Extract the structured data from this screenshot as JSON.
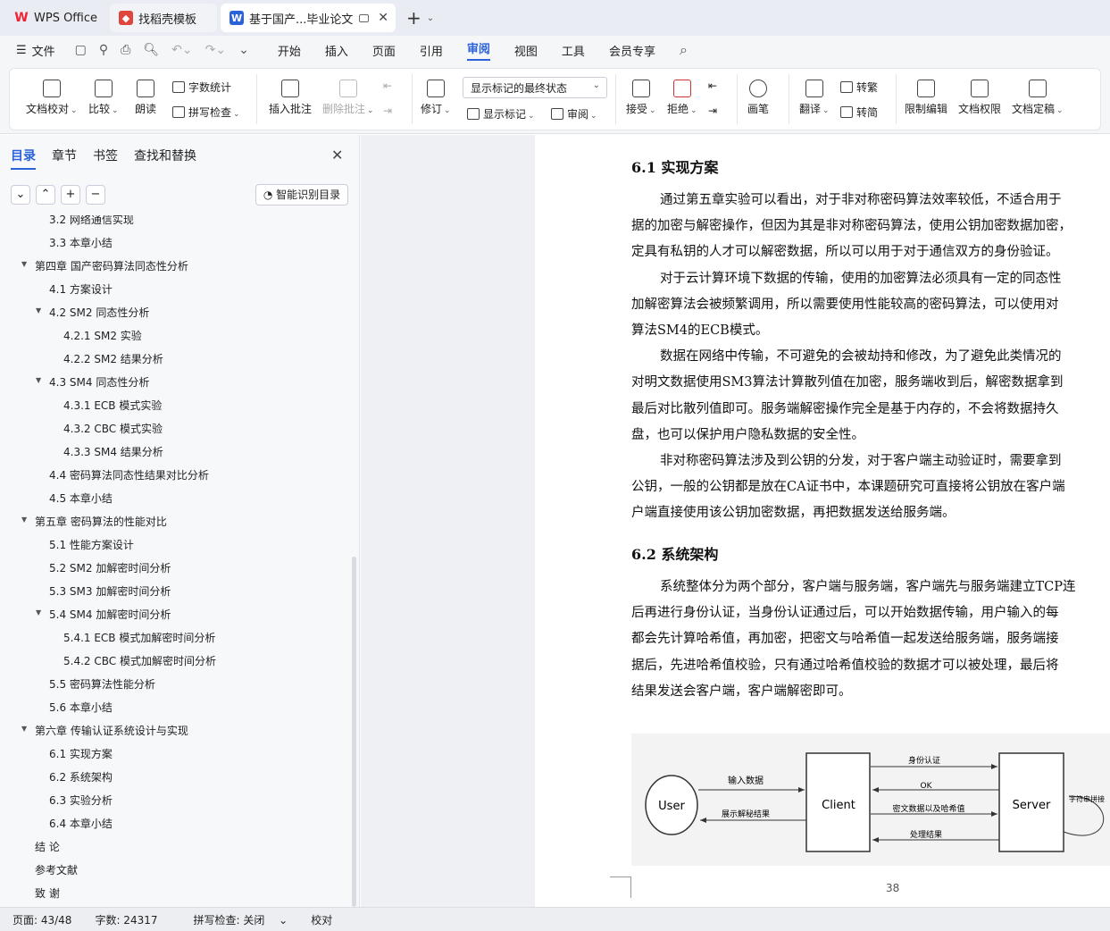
{
  "tabs": [
    {
      "label": "WPS Office"
    },
    {
      "label": "找稻壳模板"
    },
    {
      "label": "基于国产...毕业论文"
    }
  ],
  "menu": {
    "file": "文件",
    "items": [
      "开始",
      "插入",
      "页面",
      "引用",
      "审阅",
      "视图",
      "工具",
      "会员专享"
    ]
  },
  "ribbon": {
    "doc_check": "文档校对",
    "compare": "比较",
    "read": "朗读",
    "word_count": "字数统计",
    "spell_check": "拼写检查",
    "insert_comment": "插入批注",
    "delete_comment": "删除批注",
    "revise": "修订",
    "show_state": "显示标记的最终状态",
    "show_mark": "显示标记",
    "review_pane": "审阅",
    "accept": "接受",
    "reject": "拒绝",
    "pen": "画笔",
    "translate": "翻译",
    "to_trad": "转繁",
    "to_simp": "转简",
    "restrict_edit": "限制编辑",
    "doc_perm": "文档权限",
    "doc_finalize": "文档定稿"
  },
  "nav": {
    "tabs": [
      "目录",
      "章节",
      "书签",
      "查找和替换"
    ],
    "smart": "智能识别目录"
  },
  "toc": [
    {
      "t": "3.2  网络通信实现",
      "l": 2
    },
    {
      "t": "3.3  本章小结",
      "l": 2
    },
    {
      "t": "第四章  国产密码算法同态性分析",
      "l": 1,
      "a": true
    },
    {
      "t": "4.1  方案设计",
      "l": 2
    },
    {
      "t": "4.2 SM2 同态性分析",
      "l": 2,
      "a": true
    },
    {
      "t": "4.2.1 SM2 实验",
      "l": 3
    },
    {
      "t": "4.2.2 SM2 结果分析",
      "l": 3
    },
    {
      "t": "4.3 SM4 同态性分析",
      "l": 2,
      "a": true
    },
    {
      "t": "4.3.1 ECB 模式实验",
      "l": 3
    },
    {
      "t": "4.3.2 CBC 模式实验",
      "l": 3
    },
    {
      "t": "4.3.3 SM4 结果分析",
      "l": 3
    },
    {
      "t": "4.4  密码算法同态性结果对比分析",
      "l": 2
    },
    {
      "t": "4.5 本章小结",
      "l": 2
    },
    {
      "t": "第五章  密码算法的性能对比",
      "l": 1,
      "a": true
    },
    {
      "t": "5.1  性能方案设计",
      "l": 2
    },
    {
      "t": "5.2 SM2 加解密时间分析",
      "l": 2
    },
    {
      "t": "5.3 SM3 加解密时间分析",
      "l": 2
    },
    {
      "t": "5.4 SM4 加解密时间分析",
      "l": 2,
      "a": true
    },
    {
      "t": "5.4.1 ECB 模式加解密时间分析",
      "l": 3
    },
    {
      "t": "5.4.2 CBC 模式加解密时间分析",
      "l": 3
    },
    {
      "t": "5.5  密码算法性能分析",
      "l": 2
    },
    {
      "t": "5.6  本章小结",
      "l": 2
    },
    {
      "t": "第六章  传输认证系统设计与实现",
      "l": 1,
      "a": true
    },
    {
      "t": "6.1  实现方案",
      "l": 2
    },
    {
      "t": "6.2  系统架构",
      "l": 2
    },
    {
      "t": "6.3  实验分析",
      "l": 2
    },
    {
      "t": "6.4  本章小结",
      "l": 2
    },
    {
      "t": "结    论",
      "l": 1
    },
    {
      "t": "参考文献",
      "l": 1
    },
    {
      "t": "致    谢",
      "l": 1
    }
  ],
  "doc": {
    "h61": "6.1  实现方案",
    "h62": "6.2  系统架构",
    "lines": [
      {
        "t": "通过第五章实验可以看出，对于非对称密码算法效率较低，不适合用于",
        "ind": true
      },
      {
        "t": "据的加密与解密操作，但因为其是非对称密码算法，使用公钥加密数据加密，"
      },
      {
        "t": "定具有私钥的人才可以解密数据，所以可以用于对于通信双方的身份验证。"
      },
      {
        "t": "对于云计算环境下数据的传输，使用的加密算法必须具有一定的同态性",
        "ind": true
      },
      {
        "t": "加解密算法会被频繁调用，所以需要使用性能较高的密码算法，可以使用对"
      },
      {
        "t": "算法SM4的ECB模式。"
      },
      {
        "t": "数据在网络中传输，不可避免的会被劫持和修改，为了避免此类情况的",
        "ind": true
      },
      {
        "t": "对明文数据使用SM3算法计算散列值在加密，服务端收到后，解密数据拿到"
      },
      {
        "t": "最后对比散列值即可。服务端解密操作完全是基于内存的，不会将数据持久"
      },
      {
        "t": "盘，也可以保护用户隐私数据的安全性。"
      },
      {
        "t": "非对称密码算法涉及到公钥的分发，对于客户端主动验证时，需要拿到",
        "ind": true
      },
      {
        "t": "公钥，一般的公钥都是放在CA证书中，本课题研究可直接将公钥放在客户端"
      },
      {
        "t": "户端直接使用该公钥加密数据，再把数据发送给服务端。"
      }
    ],
    "lines2": [
      {
        "t": "系统整体分为两个部分，客户端与服务端，客户端先与服务端建立TCP连",
        "ind": true
      },
      {
        "t": "后再进行身份认证，当身份认证通过后，可以开始数据传输，用户输入的每"
      },
      {
        "t": "都会先计算哈希值，再加密，把密文与哈希值一起发送给服务端，服务端接"
      },
      {
        "t": "据后，先进哈希值校验，只有通过哈希值校验的数据才可以被处理，最后将"
      },
      {
        "t": "结果发送会客户端，客户端解密即可。"
      }
    ],
    "diagram": {
      "user": "User",
      "client": "Client",
      "server": "Server",
      "input": "输入数据",
      "show": "展示解秘结果",
      "auth": "身份认证",
      "ok": "OK",
      "cipher": "密文数据以及哈希值",
      "result": "处理结果",
      "concat": "字符串拼接"
    },
    "page_num": "38"
  },
  "status": {
    "page": "页面: 43/48",
    "words": "字数: 24317",
    "spell": "拼写检查: 关闭",
    "proof": "校对"
  }
}
